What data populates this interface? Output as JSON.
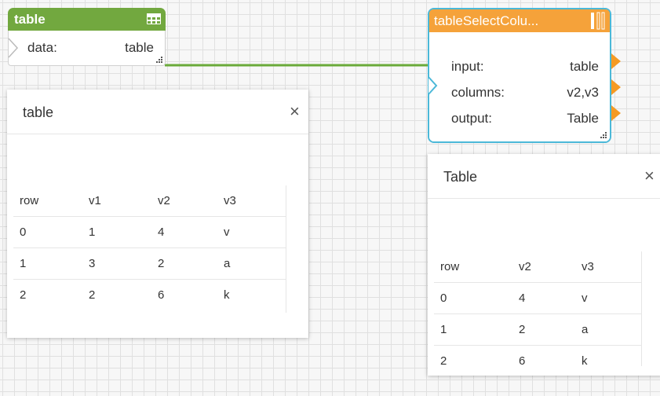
{
  "blocks": {
    "source": {
      "title": "table",
      "color": "#72a83f",
      "header_icon": "table-icon",
      "ports": [
        {
          "name": "data:",
          "value": "table"
        }
      ]
    },
    "select": {
      "title": "tableSelectColu...",
      "color": "#f5a23a",
      "border_color": "#4bb8d8",
      "header_icon": "resize-handle-icon",
      "ports": [
        {
          "name": "input:",
          "value": "table"
        },
        {
          "name": "columns:",
          "value": "v2,v3"
        },
        {
          "name": "output:",
          "value": "Table"
        }
      ]
    }
  },
  "wire_color": "#6aaa3a",
  "panels": {
    "left": {
      "title": "table",
      "close_glyph": "×",
      "columns": [
        "row",
        "v1",
        "v2",
        "v3"
      ],
      "rows": [
        [
          "0",
          "1",
          "4",
          "v"
        ],
        [
          "1",
          "3",
          "2",
          "a"
        ],
        [
          "2",
          "2",
          "6",
          "k"
        ]
      ]
    },
    "right": {
      "title": "Table",
      "close_glyph": "×",
      "columns": [
        "row",
        "v2",
        "v3"
      ],
      "rows": [
        [
          "0",
          "4",
          "v"
        ],
        [
          "1",
          "2",
          "a"
        ],
        [
          "2",
          "6",
          "k"
        ]
      ]
    }
  }
}
